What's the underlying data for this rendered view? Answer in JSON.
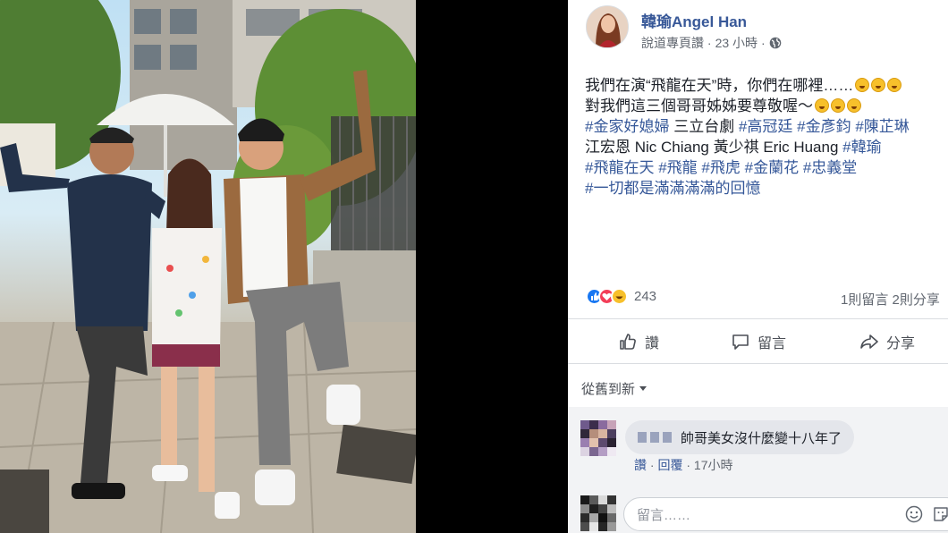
{
  "post": {
    "author": "韓瑜Angel Han",
    "meta_prefix": "說道專頁讚 · ",
    "time": "23 小時",
    "meta_sep": " · ",
    "text_lines": [
      {
        "parts": [
          {
            "t": "我們在演“飛龍在天”時，你們在哪裡……",
            "k": "text"
          }
        ],
        "emoji_count": 3
      },
      {
        "parts": [
          {
            "t": "對我們這三個哥哥姊姊要尊敬喔～",
            "k": "text"
          }
        ],
        "emoji_count": 3
      },
      {
        "parts": [
          {
            "t": "#金家好媳婦",
            "k": "tag"
          },
          {
            "t": " 三立台劇 ",
            "k": "text"
          },
          {
            "t": "#高冠廷",
            "k": "tag"
          },
          {
            "t": " ",
            "k": "text"
          },
          {
            "t": "#金彥鈞",
            "k": "tag"
          },
          {
            "t": " ",
            "k": "text"
          },
          {
            "t": "#陳芷琳",
            "k": "tag"
          }
        ],
        "emoji_count": 0
      },
      {
        "parts": [
          {
            "t": "江宏恩 Nic Chiang 黃少祺 Eric Huang ",
            "k": "text"
          },
          {
            "t": "#韓瑜",
            "k": "tag"
          }
        ],
        "emoji_count": 0
      },
      {
        "parts": [
          {
            "t": "#飛龍在天",
            "k": "tag"
          },
          {
            "t": " ",
            "k": "text"
          },
          {
            "t": "#飛龍",
            "k": "tag"
          },
          {
            "t": " ",
            "k": "text"
          },
          {
            "t": "#飛虎",
            "k": "tag"
          },
          {
            "t": " ",
            "k": "text"
          },
          {
            "t": "#金蘭花",
            "k": "tag"
          },
          {
            "t": " ",
            "k": "text"
          },
          {
            "t": "#忠義堂",
            "k": "tag"
          }
        ],
        "emoji_count": 0
      },
      {
        "parts": [
          {
            "t": "#一切都是滿滿滿滿的回憶",
            "k": "tag"
          }
        ],
        "emoji_count": 0
      }
    ]
  },
  "stats": {
    "reaction_count": "243",
    "comments_shares": "1則留言  2則分享"
  },
  "actions": {
    "like": "讚",
    "comment": "留言",
    "share": "分享"
  },
  "sort_label": "從舊到新",
  "comment": {
    "text": "帥哥美女沒什麼變十八年了",
    "like_link": "讚",
    "reply_link": "回覆",
    "time": "17小時"
  },
  "reply_box": {
    "placeholder": "留言……"
  },
  "icons": {
    "globe": "globe-icon",
    "like": "thumbs-up-icon",
    "comment": "speech-bubble-icon",
    "share": "share-arrow-icon",
    "smile": "smiley-icon",
    "sticker": "sticker-icon"
  },
  "colors": {
    "link_blue": "#385898",
    "hashtag_blue": "#365899",
    "meta_gray": "#616770"
  }
}
